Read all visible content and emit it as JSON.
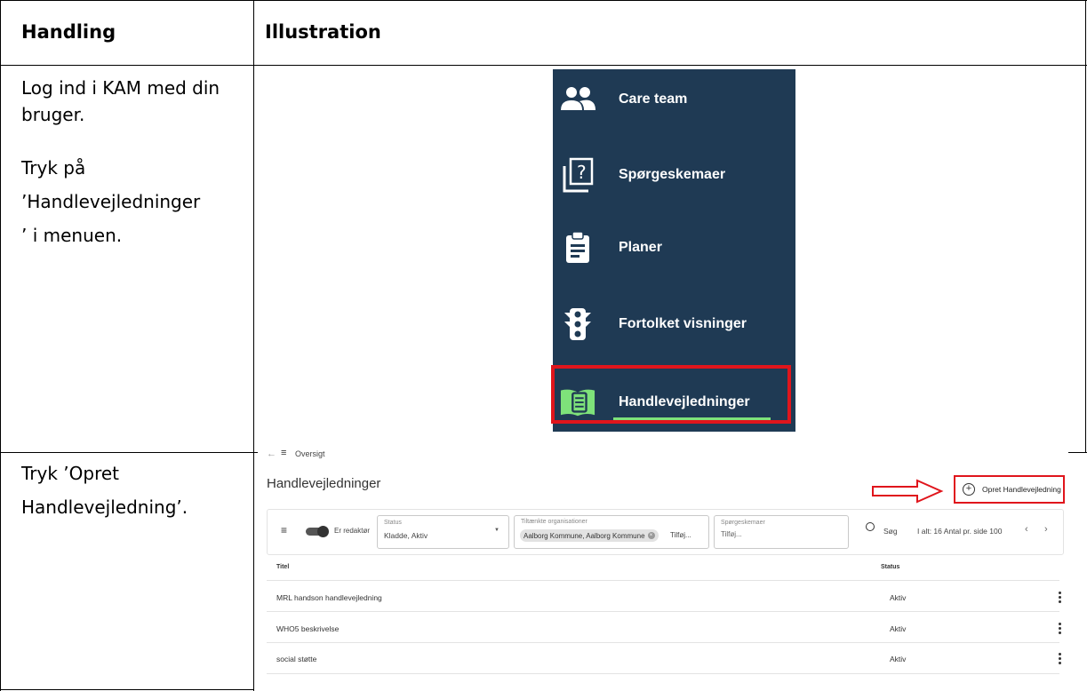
{
  "table": {
    "headers": {
      "action": "Handling",
      "illustration": "Illustration"
    },
    "row1": {
      "step1": "Log ind i KAM med din bruger.",
      "step2_line1": "Tryk på",
      "step2_line2": "’Handlevejledninger",
      "step2_line3": "’ i menuen."
    },
    "row2": {
      "step_line1": "Tryk ’Opret",
      "step_line2": "Handlevejledning’."
    }
  },
  "menu": {
    "items": [
      {
        "label": "Care team",
        "icon": "people-icon"
      },
      {
        "label": "Spørgeskemaer",
        "icon": "questionnaire-icon"
      },
      {
        "label": "Planer",
        "icon": "clipboard-icon"
      },
      {
        "label": "Fortolket visninger",
        "icon": "traffic-light-icon"
      },
      {
        "label": "Handlevejledninger",
        "icon": "book-icon"
      }
    ],
    "colors": {
      "background": "#1f3a54",
      "highlight": "#e0151c",
      "active": "#7ee27a"
    }
  },
  "screenshot": {
    "breadcrumb": "Oversigt",
    "title": "Handlevejledninger",
    "create_button": "Opret Handlevejledning",
    "editor_toggle": "Er redaktør",
    "status_label": "Status",
    "status_value": "Kladde, Aktiv",
    "orgs_label": "Tiltænkte organisationer",
    "orgs_chip": "Aalborg Kommune, Aalborg Kommune",
    "orgs_add": "Tilføj...",
    "questionnaires_label": "Spørgeskemaer",
    "questionnaires_placeholder": "Tilføj...",
    "search_label": "Søg",
    "pagination": "I alt: 16 Antal pr. side 100",
    "col_title": "Titel",
    "col_status": "Status",
    "rows": [
      {
        "title": "MRL handson handlevejledning",
        "status": "Aktiv"
      },
      {
        "title": "WHO5 beskrivelse",
        "status": "Aktiv"
      },
      {
        "title": "social støtte",
        "status": "Aktiv"
      }
    ]
  }
}
